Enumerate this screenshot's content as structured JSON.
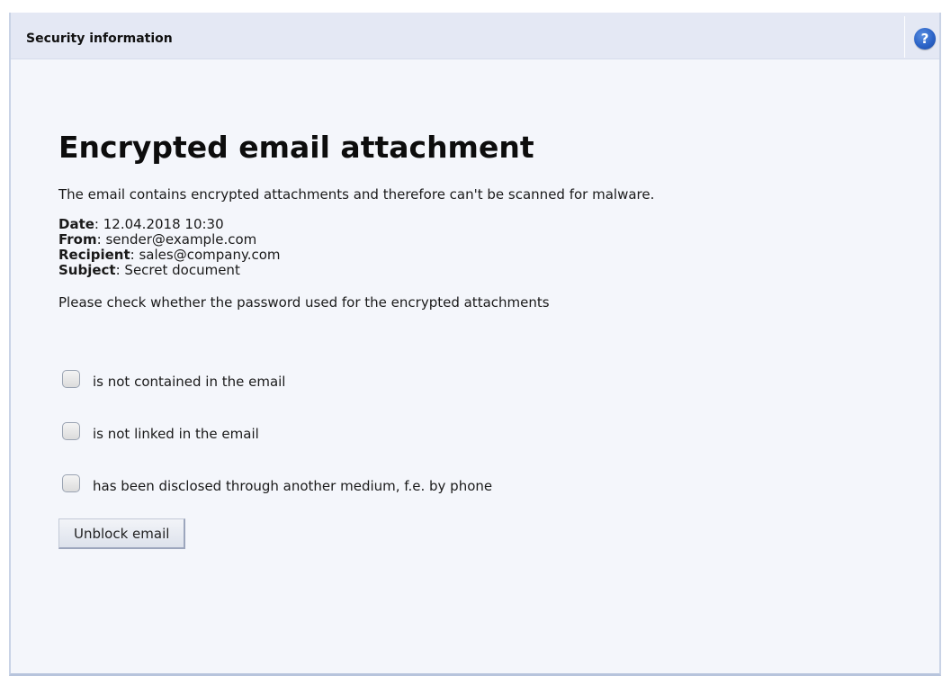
{
  "header": {
    "title": "Security information",
    "help_icon": "question-circle-icon",
    "help_label": "?"
  },
  "main": {
    "title": "Encrypted email attachment",
    "intro": "The email contains encrypted attachments and therefore can't be scanned for malware.",
    "meta": [
      {
        "key": "Date",
        "value": ": 12.04.2018 10:30"
      },
      {
        "key": "From",
        "value": ": sender@example.com"
      },
      {
        "key": "Recipient",
        "value": ": sales@company.com"
      },
      {
        "key": "Subject",
        "value": ": Secret document"
      }
    ],
    "check_prompt": "Please check whether the password used for the encrypted attachments",
    "checks": [
      {
        "label": "is not contained in the email"
      },
      {
        "label": "is not linked in the email"
      },
      {
        "label": "has been disclosed through another medium, f.e. by phone"
      }
    ],
    "button_label": "Unblock email"
  },
  "colors": {
    "header_bg": "#e4e8f4",
    "panel_bg": "#f4f6fb",
    "accent": "#2b63c7"
  }
}
